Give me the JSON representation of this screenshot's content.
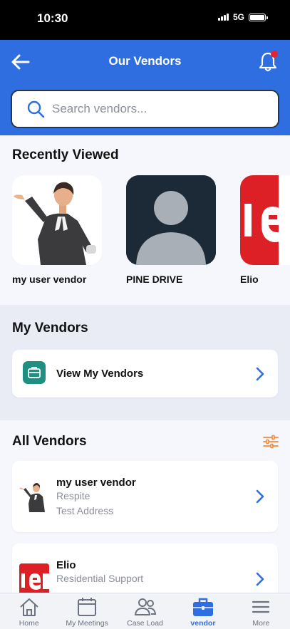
{
  "status_bar": {
    "time": "10:30",
    "network": "5G"
  },
  "header": {
    "title": "Our Vendors"
  },
  "search": {
    "placeholder": "Search vendors..."
  },
  "recently_viewed": {
    "title": "Recently Viewed",
    "items": [
      {
        "name": "my user vendor",
        "image": "lawyer-illustration"
      },
      {
        "name": "PINE DRIVE",
        "image": "default-avatar"
      },
      {
        "name": "Elio",
        "image": "red-logo"
      }
    ]
  },
  "my_vendors": {
    "title": "My Vendors",
    "view_label": "View My Vendors"
  },
  "all_vendors": {
    "title": "All Vendors",
    "items": [
      {
        "name": "my user vendor",
        "type": "Respite",
        "address": "Test Address",
        "image": "lawyer-illustration"
      },
      {
        "name": "Elio",
        "type": "Residential Support",
        "address": "",
        "image": "red-logo"
      }
    ]
  },
  "tab_bar": {
    "tabs": [
      {
        "label": "Home",
        "icon": "home-icon"
      },
      {
        "label": "My Meetings",
        "icon": "calendar-icon"
      },
      {
        "label": "Case Load",
        "icon": "people-icon"
      },
      {
        "label": "vendor",
        "icon": "briefcase-icon"
      },
      {
        "label": "More",
        "icon": "menu-icon"
      }
    ],
    "active": "vendor"
  },
  "colors": {
    "brand_blue": "#2f6ee0",
    "teal": "#1f8f82",
    "accent_orange": "#f08a3c",
    "notification_red": "#e8232f"
  }
}
